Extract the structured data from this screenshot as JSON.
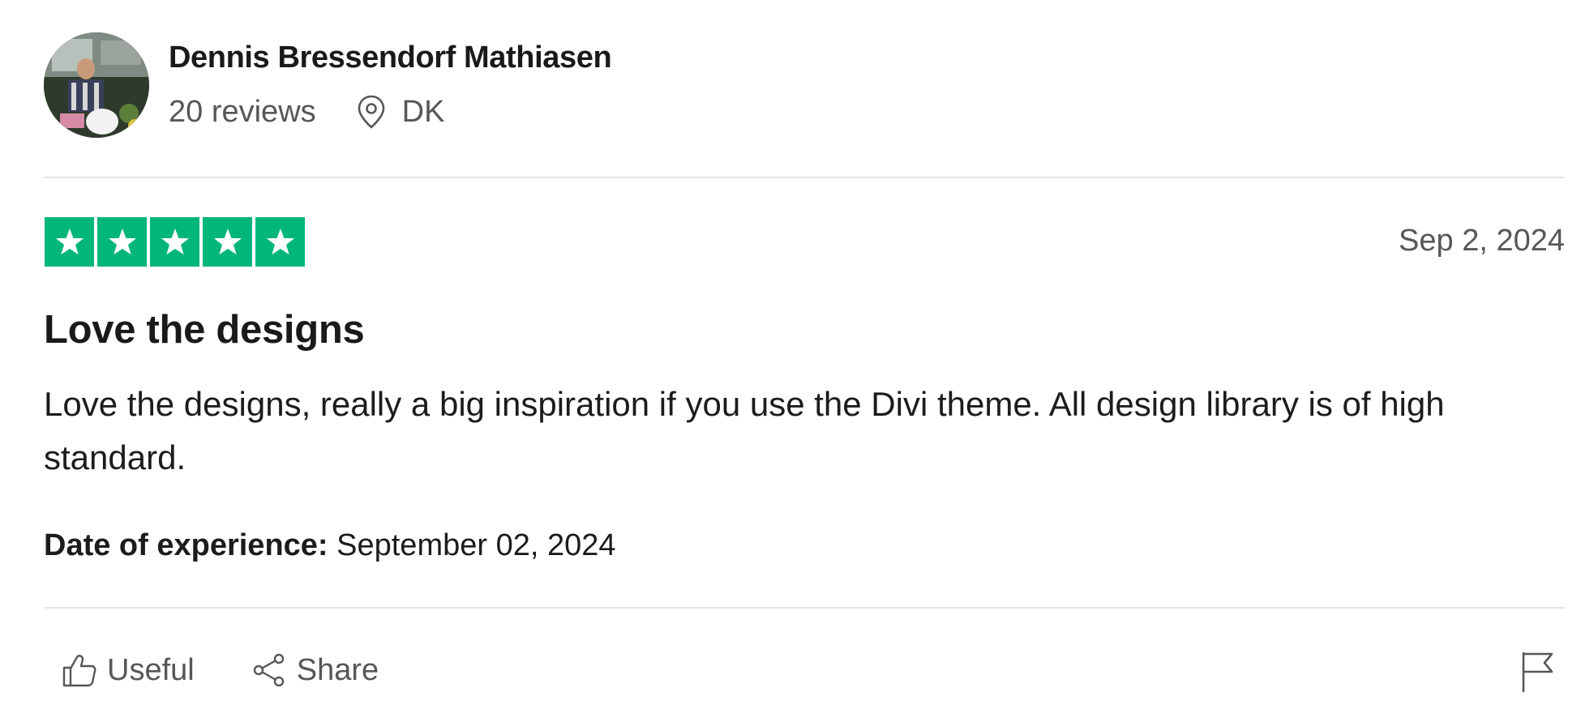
{
  "consumer": {
    "name": "Dennis Bressendorf Mathiasen",
    "reviews_count": "20 reviews",
    "country": "DK"
  },
  "review": {
    "rating": 5,
    "rating_max": 5,
    "star_color": "#00b67a",
    "date": "Sep 2, 2024",
    "title": "Love the designs",
    "text": "Love the designs, really a big inspiration if you use the Divi theme. All design library is of high standard.",
    "experience_label": "Date of experience:",
    "experience_date": "September 02, 2024"
  },
  "actions": {
    "useful_label": "Useful",
    "share_label": "Share",
    "flag_icon": "flag-icon"
  }
}
